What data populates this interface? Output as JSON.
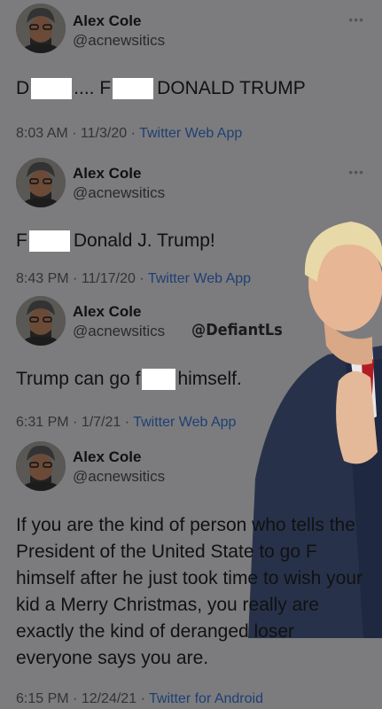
{
  "author": {
    "name": "Alex Cole",
    "handle": "@acnewsitics"
  },
  "watermark": "@DefiantLs",
  "more_icon": "ellipsis-icon",
  "colors": {
    "background": "#7c7c7e",
    "app_link": "#1f3f72",
    "redaction": "#ffffff"
  },
  "tweets": [
    {
      "parts": [
        "D",
        ".... F",
        "DONALD TRUMP"
      ],
      "time": "8:03 AM",
      "date": "11/3/20",
      "app": "Twitter Web App"
    },
    {
      "parts": [
        "F",
        "Donald J. Trump!"
      ],
      "time": "8:43 PM",
      "date": "11/17/20",
      "app": "Twitter Web App"
    },
    {
      "parts": [
        "Trump can go f",
        "himself."
      ],
      "time": "6:31 PM",
      "date": "1/7/21",
      "app": "Twitter Web App"
    },
    {
      "text": "If you are the kind of person who tells the President of the United State to go F himself after he just took time to wish your kid a Merry Christmas, you really are exactly the kind of deranged loser everyone says you are.",
      "time": "6:15 PM",
      "date": "12/24/21",
      "app": "Twitter for Android"
    }
  ],
  "separator": " · "
}
